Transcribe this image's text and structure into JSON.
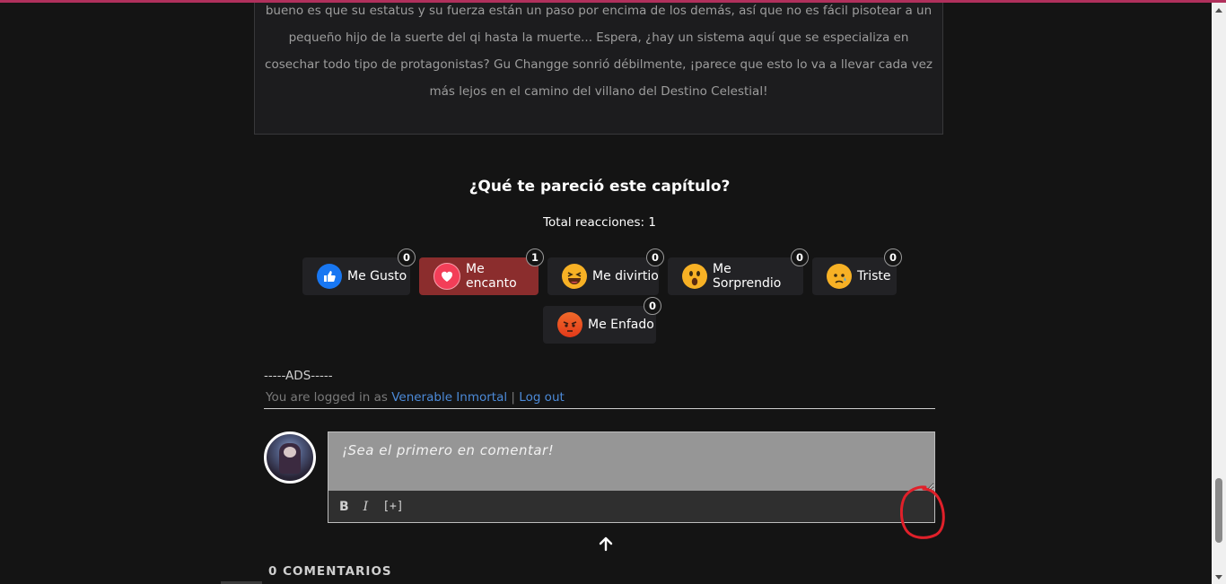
{
  "synopsis": {
    "text": "bueno es que su estatus y su fuerza están un paso por encima de los demás, así que no es fácil pisotear a un pequeño hijo de la suerte del qi hasta la muerte... Espera, ¿hay un sistema aquí que se especializa en cosechar todo tipo de protagonistas? Gu Changge sonrió débilmente, ¡parece que esto lo va a llevar cada vez más lejos en el camino del villano del Destino Celestial!"
  },
  "reactions_section": {
    "title": "¿Qué te pareció este capítulo?",
    "total_label": "Total reacciones: 1",
    "items": [
      {
        "label": "Me Gusto",
        "count": "0",
        "icon": "like-icon",
        "color": "#1877f2",
        "active": false
      },
      {
        "label": "Me encanto",
        "count": "1",
        "icon": "love-icon",
        "color": "#f33e58",
        "active": true
      },
      {
        "label": "Me divirtio",
        "count": "0",
        "icon": "haha-icon",
        "color": "#f7b125",
        "active": false
      },
      {
        "label": "Me Sorprendio",
        "count": "0",
        "icon": "wow-icon",
        "color": "#f7b125",
        "active": false
      },
      {
        "label": "Triste",
        "count": "0",
        "icon": "sad-icon",
        "color": "#f7b125",
        "active": false
      },
      {
        "label": "Me Enfado",
        "count": "0",
        "icon": "angry-icon",
        "color": "#e9710f",
        "active": false
      }
    ]
  },
  "ads_label": "-----ADS-----",
  "login": {
    "prefix": "You are logged in as",
    "username": "Venerable Inmortal",
    "separator": "|",
    "logout": "Log out"
  },
  "comment_form": {
    "placeholder": "¡Sea el primero en comentar!",
    "tools": {
      "bold": "B",
      "italic": "I",
      "more": "[+]"
    }
  },
  "comments_header": "0 COMENTARIOS",
  "colors": {
    "accent_top": "#b0305c",
    "active_reaction": "#8b2d2d",
    "link": "#4c8ad8",
    "annotation": "#e0202a"
  }
}
